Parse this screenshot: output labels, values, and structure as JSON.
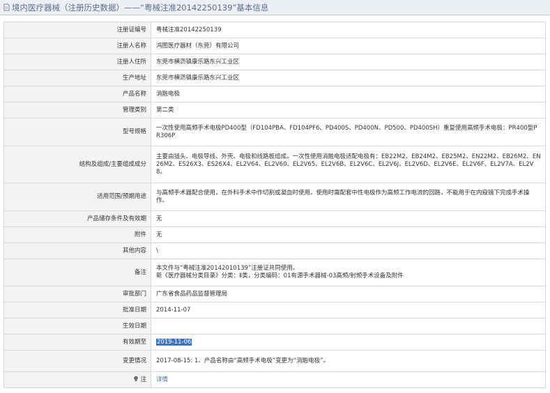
{
  "page": {
    "title": "境内医疗器械（注册历史数据）——“粤械注准20142250139”基本信息"
  },
  "rows": [
    {
      "label": "注册证编号",
      "value": "粤械注准20142250139"
    },
    {
      "label": "注册人名称",
      "value": "鸿图医疗器材（东莞）有限公司"
    },
    {
      "label": "注册人住所",
      "value": "东莞市横沥镇康乐路东兴工业区"
    },
    {
      "label": "生产地址",
      "value": "东莞市横沥镇康乐路东兴工业区"
    },
    {
      "label": "产品名称",
      "value": "消融电极"
    },
    {
      "label": "管理类别",
      "value": "第二类"
    },
    {
      "label": "型号规格",
      "value": "一次性使用高频手术电极PD400型（FD104PBA、FD104PF6、PD400S、PD400N、PD500、PD400SH）重复使用高频手术电极：PR400型PR306P"
    },
    {
      "label": "结构及组成/主要组成成分",
      "value": "主要由插头、电极导线、外壳、电极和线路板组成。一次性使用消融电极适配电极有：EB22M2、EB24M2、EB25M2、EN22M2、EB26M2、EN26M2、ES26X3、ES26X4、EL2V64、EL2V60、EL2V65、EL2V6B、EL2V6C、EL2V6J、EL2V6D、EL2V6E、EL2V6F、EL2V7A、EL2V8。"
    },
    {
      "label": "适用范围/预期用途",
      "value": "与高频手术器配合使用，在外科手术中作切割或凝血时使用。使用时需配套中性电极作为高频工作电流的回路，不能用于在内窥镜下完成手术操作。"
    },
    {
      "label": "产品储存条件及有效期",
      "value": "无"
    },
    {
      "label": "附件",
      "value": "无"
    },
    {
      "label": "其他内容",
      "value": "\\"
    },
    {
      "label": "备注",
      "value": "本文件与“粤械注准20142010139”注册证共同使用。",
      "value2": "新《医疗器械分类目录》分类：Ⅱ类，分类编码：01有源手术器械-03高频/射频手术设备及附件"
    },
    {
      "label": "审批部门",
      "value": "广东省食品药品监督管理局"
    },
    {
      "label": "批准日期",
      "value": "2014-11-07"
    },
    {
      "label": "生效日期",
      "value": ""
    },
    {
      "label": "有效期至",
      "value": "2019-11-06"
    },
    {
      "label": "变更情况",
      "value": "2017-08-15: 1、产品名称由“高频手术电极”变更为“消融电极”。"
    },
    {
      "label": "注",
      "value": "详情"
    }
  ],
  "icons": {
    "title": "document-icon",
    "note": "lightbulb-icon"
  },
  "colors": {
    "highlight_bg": "#3a73c9",
    "link": "#3a6fb7",
    "title_text": "#5b6f8c"
  }
}
